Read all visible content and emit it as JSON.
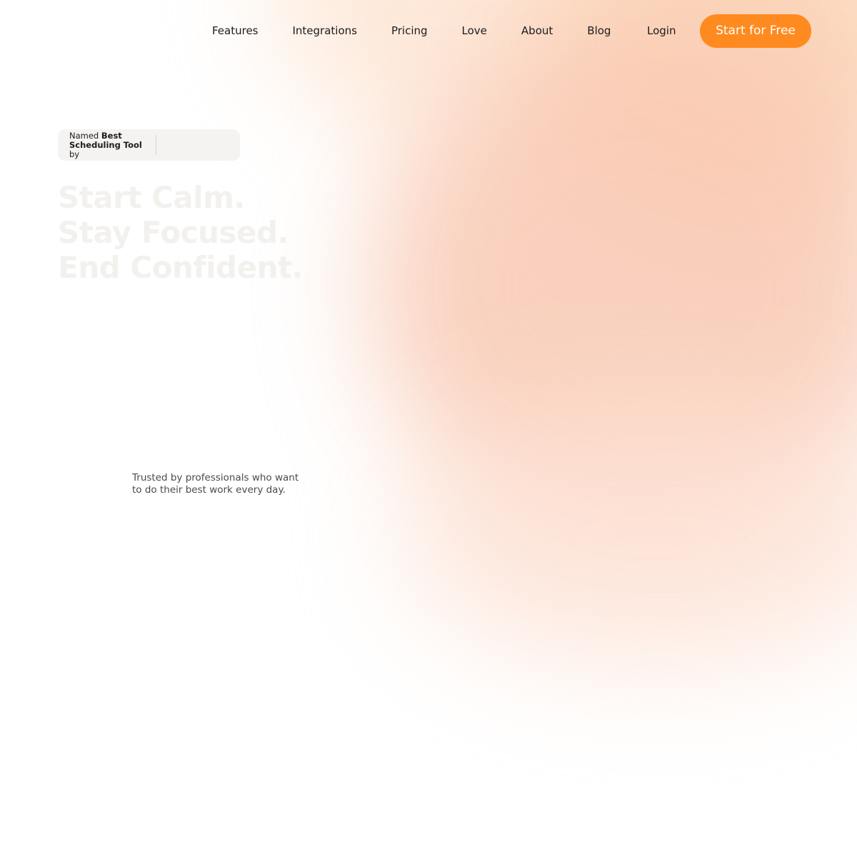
{
  "nav": {
    "items": [
      {
        "label": "Features"
      },
      {
        "label": "Integrations"
      },
      {
        "label": "Pricing"
      },
      {
        "label": "Love"
      },
      {
        "label": "About"
      },
      {
        "label": "Blog"
      }
    ],
    "login_label": "Login",
    "cta_label": "Start for Free"
  },
  "award": {
    "prefix": "Named",
    "highlight": "Best Scheduling Tool",
    "suffix": "by"
  },
  "hero": {
    "lines": [
      "Start Calm.",
      "Stay Focused.",
      "End Confident."
    ]
  },
  "trusted": {
    "text": "Trusted by professionals who want to do their best work every day."
  },
  "colors": {
    "accent": "#ff8a1f",
    "badge_bg": "#f4f3f1",
    "glow": "#f9c9b3",
    "headline": "#f3f1ee"
  }
}
